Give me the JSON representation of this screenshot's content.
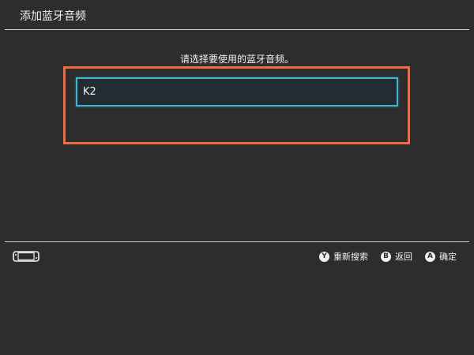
{
  "header": {
    "title": "添加蓝牙音频"
  },
  "main": {
    "prompt": "请选择要使用的蓝牙音频。",
    "devices": [
      {
        "name": "K2"
      }
    ]
  },
  "footer": {
    "console_icon": "console-handheld-icon",
    "actions": [
      {
        "button": "Y",
        "label": "重新搜索"
      },
      {
        "button": "B",
        "label": "返回"
      },
      {
        "button": "A",
        "label": "确定"
      }
    ]
  },
  "colors": {
    "background": "#2d2d2d",
    "selection_border": "#3fb6d2",
    "highlight_frame": "#f26a3d",
    "item_background": "#232c33"
  }
}
